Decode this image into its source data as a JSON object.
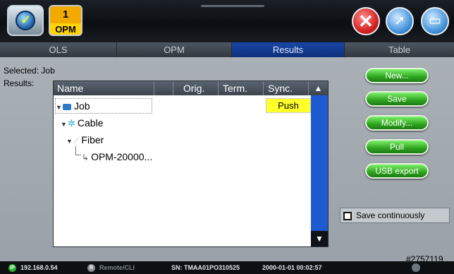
{
  "header": {
    "opm_badge_number": "1",
    "opm_badge_label": "OPM",
    "close_glyph": "✕",
    "export_glyph": "➚",
    "folder_glyph": "▭"
  },
  "tabs": [
    {
      "label": "OLS",
      "active": false
    },
    {
      "label": "OPM",
      "active": false
    },
    {
      "label": "Results",
      "active": true
    },
    {
      "label": "Table",
      "active": false
    }
  ],
  "main": {
    "selected_label": "Selected:",
    "selected_value": "Job",
    "results_label": "Results:",
    "columns": {
      "name": "Name",
      "orig": "Orig.",
      "term": "Term.",
      "sync": "Sync.",
      "sort_arrow": "▲"
    },
    "tree": [
      {
        "label": "Job",
        "level": 0,
        "icon": "job-icon",
        "sync": "Push"
      },
      {
        "label": "Cable",
        "level": 1,
        "icon": "cable-icon"
      },
      {
        "label": "Fiber",
        "level": 2,
        "icon": "fiber-icon"
      },
      {
        "label": "OPM-20000...",
        "level": 3,
        "icon": "opm-result-icon"
      }
    ],
    "scroll_down_arrow": "▼"
  },
  "actions": {
    "new": "New...",
    "save": "Save",
    "modify": "Modify...",
    "pull": "Pull",
    "usb_export": "USB export",
    "save_continuously": "Save continuously"
  },
  "tag": "#2757119",
  "status": {
    "ip_icon": "IP",
    "ip": "192.168.0.54",
    "remote_icon": "R",
    "remote": "Remote/CLI",
    "serial": "SN: TMAA01PO310525",
    "datetime": "2000-01-01 00:02:57"
  },
  "colors": {
    "active_tab": "#1846a6",
    "push_highlight": "#ffff2a",
    "action_button": "#2fa51f",
    "close_button": "#d11d1d"
  }
}
